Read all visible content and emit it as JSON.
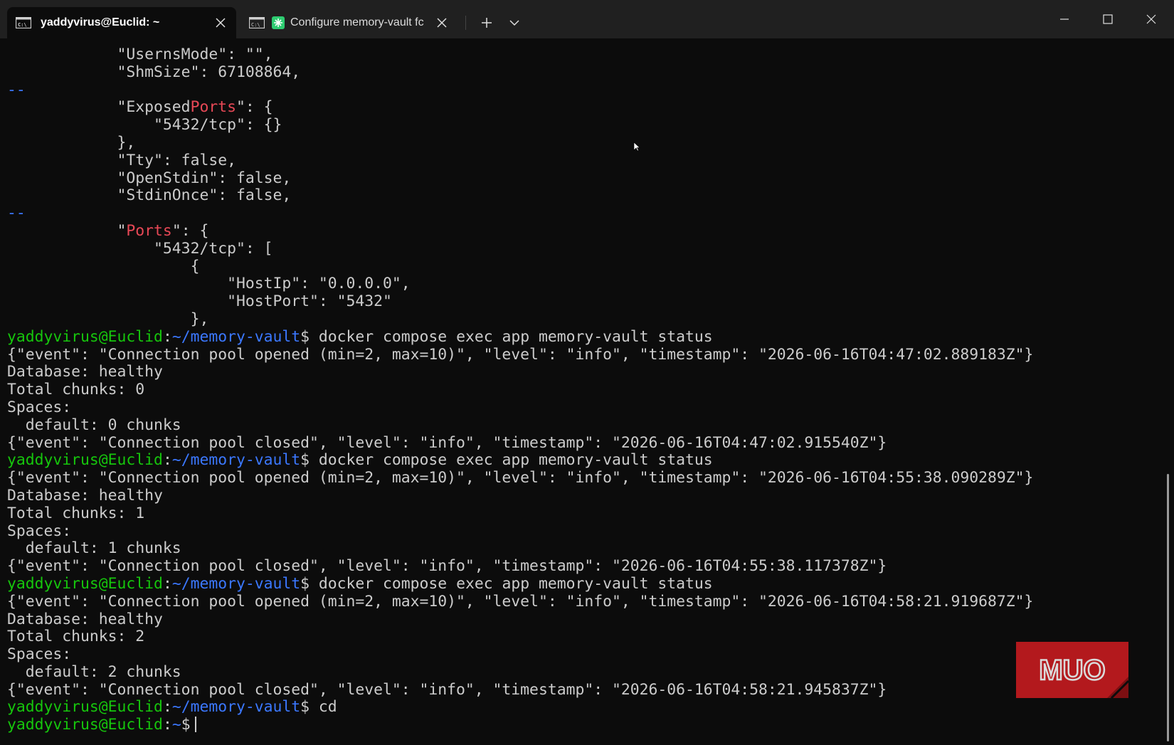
{
  "tabs": [
    {
      "label": "yaddyvirus@Euclid: ~",
      "icon": "terminal-icon",
      "active": true
    },
    {
      "label": "Configure memory-vault fc",
      "icon": "claude-icon",
      "active": false
    }
  ],
  "tabbar": {
    "new_tab_icon": "plus-icon",
    "dropdown_icon": "chevron-down-icon"
  },
  "window_controls": [
    "minimize-icon",
    "maximize-icon",
    "close-icon"
  ],
  "colors": {
    "background": "#0c0c0c",
    "tabbar": "#202020",
    "prompt_user": "#16c60c",
    "prompt_path": "#3b78ff",
    "match_highlight": "#e74856",
    "separator": "#3b78ff",
    "watermark": "#c01c1c"
  },
  "prompt": {
    "user": "yaddyvirus@Euclid",
    "path_vault": "~/memory-vault",
    "path_home": "~",
    "symbol": "$"
  },
  "terminal": {
    "l1": "            \"UsernsMode\": \"\",",
    "l2": "            \"ShmSize\": 67108864,",
    "sep": "--",
    "l4_a": "            \"Exposed",
    "l4_b": "Ports",
    "l4_c": "\": {",
    "l5": "                \"5432/tcp\": {}",
    "l6": "            },",
    "l7": "            \"Tty\": false,",
    "l8": "            \"OpenStdin\": false,",
    "l9": "            \"StdinOnce\": false,",
    "l11_a": "            \"",
    "l11_b": "Ports",
    "l11_c": "\": {",
    "l12": "                \"5432/tcp\": [",
    "l13": "                    {",
    "l14": "                        \"HostIp\": \"0.0.0.0\",",
    "l15": "                        \"HostPort\": \"5432\"",
    "l16": "                    },",
    "cmd_status": " docker compose exec app memory-vault status",
    "cmd_cd": " cd",
    "db_status": "Database: healthy",
    "spaces": "Spaces:",
    "run1": {
      "opened": "{\"event\": \"Connection pool opened (min=2, max=10)\", \"level\": \"info\", \"timestamp\": \"2026-06-16T04:47:02.889183Z\"}",
      "total": "Total chunks: 0",
      "default": "  default: 0 chunks",
      "closed": "{\"event\": \"Connection pool closed\", \"level\": \"info\", \"timestamp\": \"2026-06-16T04:47:02.915540Z\"}"
    },
    "run2": {
      "opened": "{\"event\": \"Connection pool opened (min=2, max=10)\", \"level\": \"info\", \"timestamp\": \"2026-06-16T04:55:38.090289Z\"}",
      "total": "Total chunks: 1",
      "default": "  default: 1 chunks",
      "closed": "{\"event\": \"Connection pool closed\", \"level\": \"info\", \"timestamp\": \"2026-06-16T04:55:38.117378Z\"}"
    },
    "run3": {
      "opened": "{\"event\": \"Connection pool opened (min=2, max=10)\", \"level\": \"info\", \"timestamp\": \"2026-06-16T04:58:21.919687Z\"}",
      "total": "Total chunks: 2",
      "default": "  default: 2 chunks",
      "closed": "{\"event\": \"Connection pool closed\", \"level\": \"info\", \"timestamp\": \"2026-06-16T04:58:21.945837Z\"}"
    }
  },
  "watermark": {
    "text": "MUO"
  }
}
